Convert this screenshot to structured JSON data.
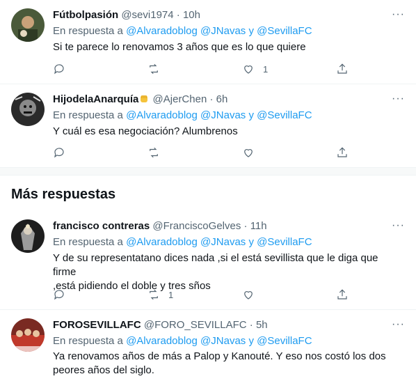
{
  "tweets": [
    {
      "display_name": "Fútbolpasión",
      "handle": "@sevi1974",
      "time": "10h",
      "reply_prefix": "En respuesta a",
      "mentions": [
        "@Alvaradoblog",
        "@JNavas",
        "y",
        "@SevillaFC"
      ],
      "text_lines": [
        "Si te parece lo renovamos 3 años que es lo que quiere"
      ],
      "like_count": "1",
      "avatar_color": "#3a4a2e"
    },
    {
      "display_name": "HijodelaAnarquía",
      "handle": "@AjerChen",
      "time": "6h",
      "reply_prefix": "En respuesta a",
      "mentions": [
        "@Alvaradoblog",
        "@JNavas",
        "y",
        "@SevillaFC"
      ],
      "text_lines": [
        "Y cuál es esa negociación? Alumbrenos"
      ],
      "like_count": "",
      "avatar_color": "#444444"
    },
    {
      "display_name": "francisco contreras",
      "handle": "@FranciscoGelves",
      "time": "11h",
      "reply_prefix": "En respuesta a",
      "mentions": [
        "@Alvaradoblog",
        "@JNavas",
        "y",
        "@SevillaFC"
      ],
      "text_lines": [
        "Y de su representatano dices nada ,si el está sevillista que le diga que firme",
        ",está pidiendo el doble y tres sños"
      ],
      "retweet_count": "1",
      "avatar_color": "#2b2b2b"
    },
    {
      "display_name": "FOROSEVILLAFC",
      "handle": "@FORO_SEVILLAFC",
      "time": "5h",
      "reply_prefix": "En respuesta a",
      "mentions": [
        "@Alvaradoblog",
        "@JNavas",
        "y",
        "@SevillaFC"
      ],
      "text_lines": [
        "Ya renovamos años de más a Palop y Kanouté. Y eso nos costó los dos",
        "peores años del siglo."
      ],
      "avatar_color": "#c0392b"
    }
  ],
  "section": {
    "more_replies": "Más respuestas"
  },
  "separator": "·",
  "more_glyph": "···",
  "colors": {
    "accent": "#1d9bf0",
    "secondary_text": "#536471",
    "primary_text": "#0f1419"
  }
}
